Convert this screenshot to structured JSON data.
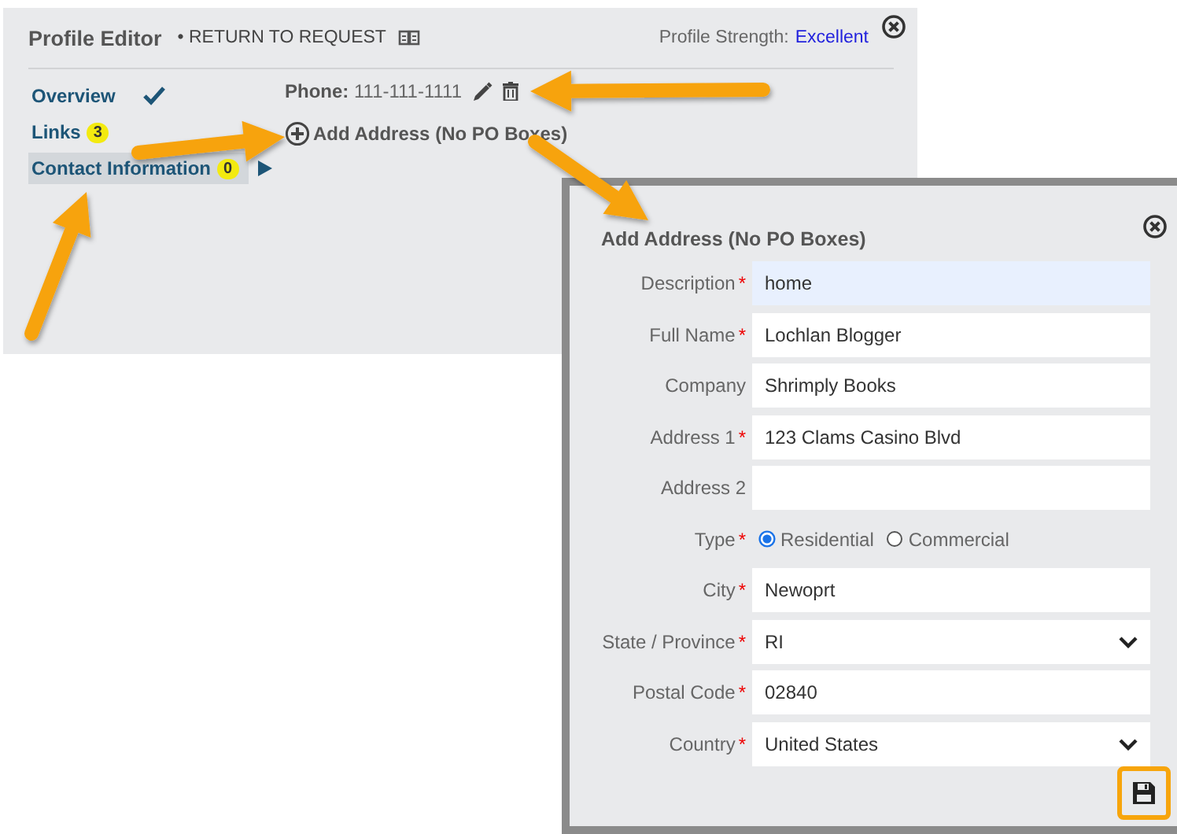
{
  "profile_editor": {
    "title": "Profile Editor",
    "return_link": "• RETURN TO REQUEST",
    "strength_label": "Profile Strength:",
    "strength_value": "Excellent",
    "nav": [
      {
        "label": "Overview",
        "kind": "check",
        "selected": false
      },
      {
        "label": "Links",
        "kind": "badge",
        "badge": "3",
        "selected": false
      },
      {
        "label": "Contact Information",
        "kind": "badge",
        "badge": "0",
        "selected": true
      }
    ],
    "phone": {
      "label": "Phone:",
      "value": "111-111-1111"
    },
    "add_address_link": "Add Address (No PO Boxes)"
  },
  "dialog": {
    "title": "Add Address (No PO Boxes)",
    "fields": [
      {
        "label": "Description",
        "required_mark": "*",
        "kind": "text",
        "value": "home",
        "autofilled": true
      },
      {
        "label": "Full Name",
        "required_mark": "*",
        "kind": "text",
        "value": "Lochlan Blogger",
        "autofilled": false
      },
      {
        "label": "Company",
        "kind": "text",
        "value": "Shrimply Books",
        "autofilled": false
      },
      {
        "label": "Address 1",
        "required_mark": "*",
        "kind": "text",
        "value": "123 Clams Casino Blvd",
        "autofilled": false
      },
      {
        "label": "Address 2",
        "kind": "text",
        "autofilled": false
      },
      {
        "label": "Type",
        "required_mark": "*",
        "kind": "radio",
        "options": [
          {
            "label": "Residential",
            "selected": true
          },
          {
            "label": "Commercial",
            "selected": false
          }
        ]
      },
      {
        "label": "City",
        "required_mark": "*",
        "kind": "text",
        "value": "Newoprt",
        "autofilled": false
      },
      {
        "label": "State / Province",
        "required_mark": "*",
        "kind": "select",
        "value": "RI"
      },
      {
        "label": "Postal Code",
        "required_mark": "*",
        "kind": "text",
        "value": "02840",
        "autofilled": false
      },
      {
        "label": "Country",
        "required_mark": "*",
        "kind": "select",
        "value": "United States"
      }
    ]
  }
}
